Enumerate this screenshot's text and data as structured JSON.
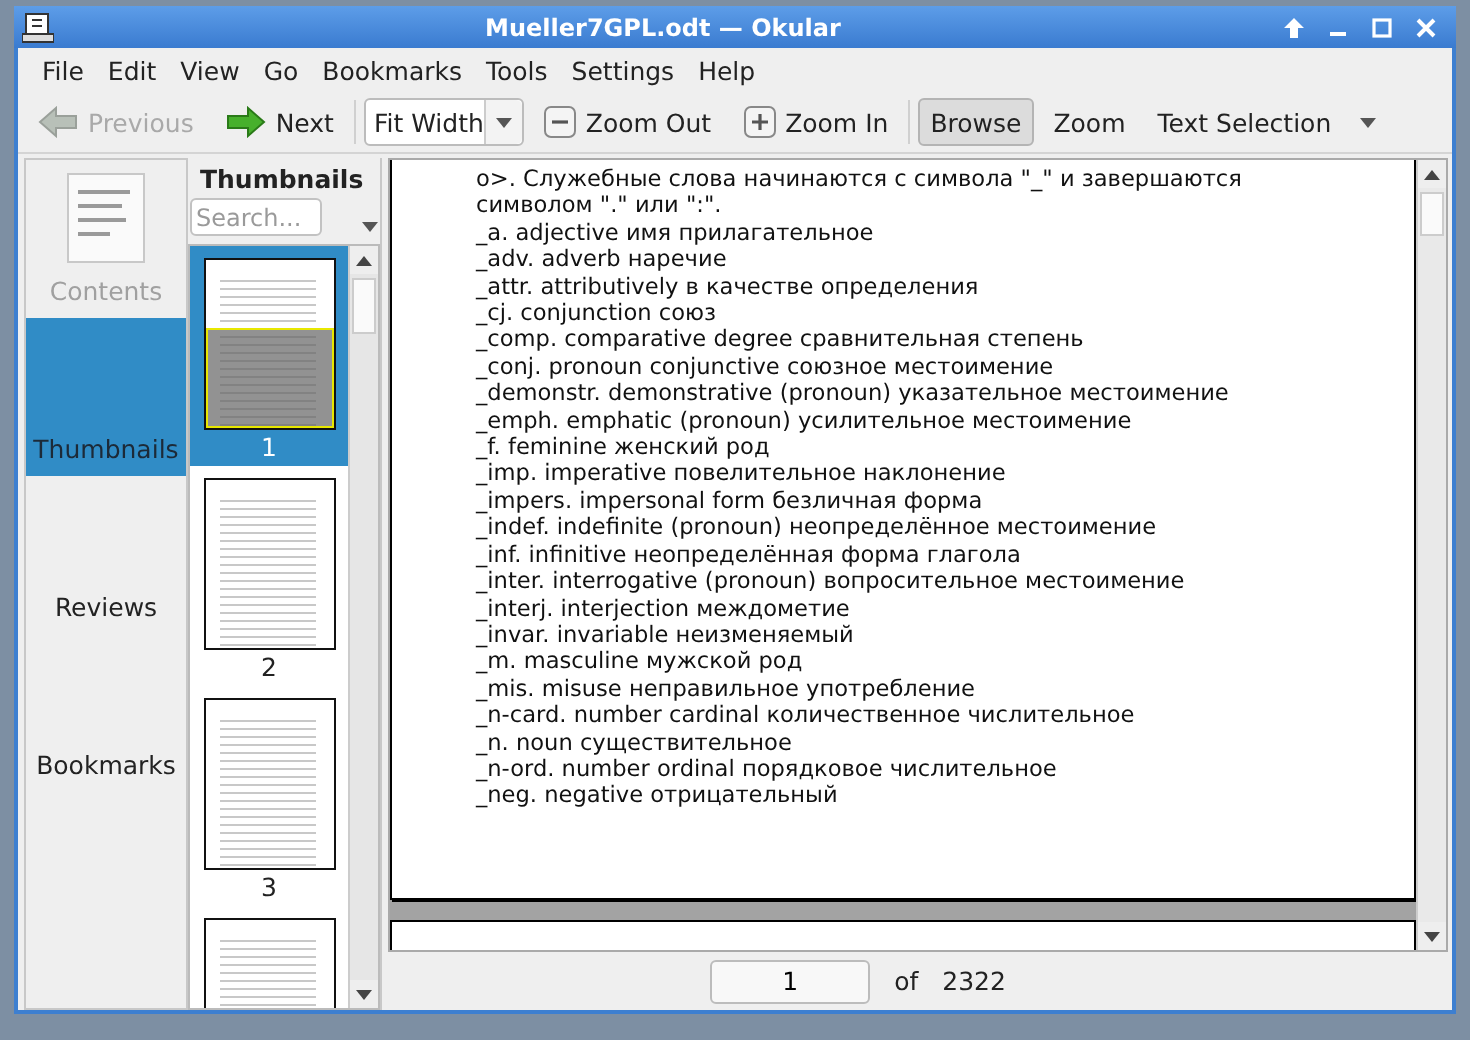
{
  "window": {
    "title": "Mueller7GPL.odt  — Okular"
  },
  "menu": [
    {
      "label": "File"
    },
    {
      "label": "Edit"
    },
    {
      "label": "View"
    },
    {
      "label": "Go"
    },
    {
      "label": "Bookmarks"
    },
    {
      "label": "Tools"
    },
    {
      "label": "Settings"
    },
    {
      "label": "Help"
    }
  ],
  "toolbar": [
    {
      "kind": "prev",
      "label": "Previous",
      "disabled": true
    },
    {
      "kind": "next",
      "label": "Next",
      "disabled": false
    },
    {
      "kind": "combo",
      "label": "Fit Width"
    },
    {
      "kind": "zoomout",
      "label": "Zoom Out"
    },
    {
      "kind": "zoomin",
      "label": "Zoom In"
    },
    {
      "kind": "mode",
      "label": "Browse",
      "selected": true
    },
    {
      "kind": "mode",
      "label": "Zoom",
      "selected": false
    },
    {
      "kind": "mode",
      "label": "Text Selection",
      "selected": false,
      "menu": true
    }
  ],
  "sidebar": {
    "items": [
      {
        "label": "Contents",
        "selected": false,
        "disabled": true
      },
      {
        "label": "Thumbnails",
        "selected": true,
        "disabled": false
      },
      {
        "label": "Reviews",
        "selected": false,
        "disabled": false
      },
      {
        "label": "Bookmarks",
        "selected": false,
        "disabled": false
      }
    ]
  },
  "thumbnails": {
    "title": "Thumbnails",
    "search": {
      "placeholder": "Search..."
    },
    "pages": [
      {
        "label": "1",
        "selected": true
      },
      {
        "label": "2",
        "selected": false
      },
      {
        "label": "3",
        "selected": false
      },
      {
        "selected": false
      }
    ]
  },
  "document": {
    "lines": [
      "o>. Служебные слова начинаются с символа \"_\" и завершаются символом \".\" или \":\".",
      "_a. adjective имя прилагательное",
      "_adv. adverb наречие",
      "_attr. attributively в качестве определения",
      "_cj. conjunction союз",
      "_comp. comparative degree сравнительная степень",
      "_conj. pronoun conjunctive союзное местоимение",
      "_demonstr. demonstrative (pronoun) указательное местоимение",
      "_emph. emphatic (pronoun) усилительное местоимение",
      "_f. feminine женский род",
      "_imp. imperative повелительное наклонение",
      "_impers. impersonal form безличная форма",
      "_indef. indefinite (pronoun) неопределённое местоимение",
      "_inf. infinitive неопределённая форма глагола",
      "_inter. interrogative (pronoun) вопросительное местоимение",
      "_interj. interjection междометие",
      "_invar. invariable неизменяемый",
      "_m. masculine мужской род",
      "_mis. misuse неправильное употребление",
      "_n-card. number cardinal количественное числительное",
      "_n. noun существительное",
      "_n-ord. number ordinal порядковое числительное",
      "_neg. negative отрицательный"
    ]
  },
  "page_nav": {
    "value": "1",
    "of": "of",
    "total": "2322"
  }
}
